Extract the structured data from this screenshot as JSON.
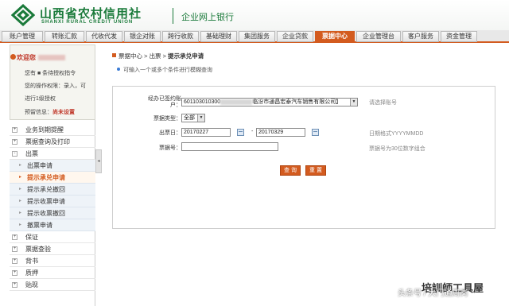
{
  "header": {
    "bank_name": "山西省农村信用社",
    "bank_name_en": "SHANXI RURAL CREDIT UNION",
    "system_name": "企业网上银行"
  },
  "nav": {
    "tabs": [
      {
        "label": "账户管理"
      },
      {
        "label": "转账汇款"
      },
      {
        "label": "代收代发"
      },
      {
        "label": "银企对账"
      },
      {
        "label": "跨行收款"
      },
      {
        "label": "基础理财"
      },
      {
        "label": "集团服务"
      },
      {
        "label": "企业贷款"
      },
      {
        "label": "票据中心",
        "active": true
      },
      {
        "label": "企业管理台"
      },
      {
        "label": "客户服务"
      },
      {
        "label": "资金管理"
      }
    ]
  },
  "welcome": {
    "greeting": "欢迎您",
    "line1": "您有 ■ 条待授权指令",
    "line2": "您的操作权限：录入，可",
    "line3": "进行1级授权",
    "line4_label": "预留信息：",
    "line4_value": "尚未设置"
  },
  "menu": {
    "items": [
      {
        "label": "业务到期提醒",
        "toggle": "+"
      },
      {
        "label": "票据查询及打印",
        "toggle": "+"
      },
      {
        "label": "出票",
        "toggle": "-"
      }
    ],
    "sub_items": [
      {
        "label": "出票申请"
      },
      {
        "label": "提示承兑申请",
        "active": true
      },
      {
        "label": "提示承兑撤回"
      },
      {
        "label": "提示收票申请"
      },
      {
        "label": "提示收票撤回"
      },
      {
        "label": "撤票申请"
      }
    ],
    "items_after": [
      {
        "label": "保证",
        "toggle": "+"
      },
      {
        "label": "票据查验",
        "toggle": "+"
      },
      {
        "label": "背书",
        "toggle": "+"
      },
      {
        "label": "质押",
        "toggle": "+"
      },
      {
        "label": "贴现",
        "toggle": "+"
      }
    ]
  },
  "breadcrumb": {
    "part1": "票据中心",
    "sep": " > ",
    "part2": "出票",
    "part3": "提示承兑申请"
  },
  "hint": "可输入一个或多个条件进行模糊查询",
  "form": {
    "account_label_line1": "经办已签约账",
    "account_label_line2": "户：",
    "account_value_prefix": "601103010300",
    "account_value_suffix": "临汾市通昌宏泰汽车销售有限公司】",
    "account_note": "请选择账号",
    "bill_type_label": "票据类型：",
    "bill_type_value": "全部",
    "issue_date_label": "出票日：",
    "issue_date_from": "20170227",
    "date_sep": "-",
    "issue_date_to": "20170329",
    "date_note": "日期格式YYYYMMDD",
    "bill_no_label": "票据号：",
    "bill_no_value": "",
    "bill_no_note": "票据号为30位数字组合",
    "query_button": "查 询",
    "reset_button": "重 置"
  },
  "watermark": {
    "brand": "培訓師工具屋",
    "source": "头条号 / 大门通周岗"
  }
}
